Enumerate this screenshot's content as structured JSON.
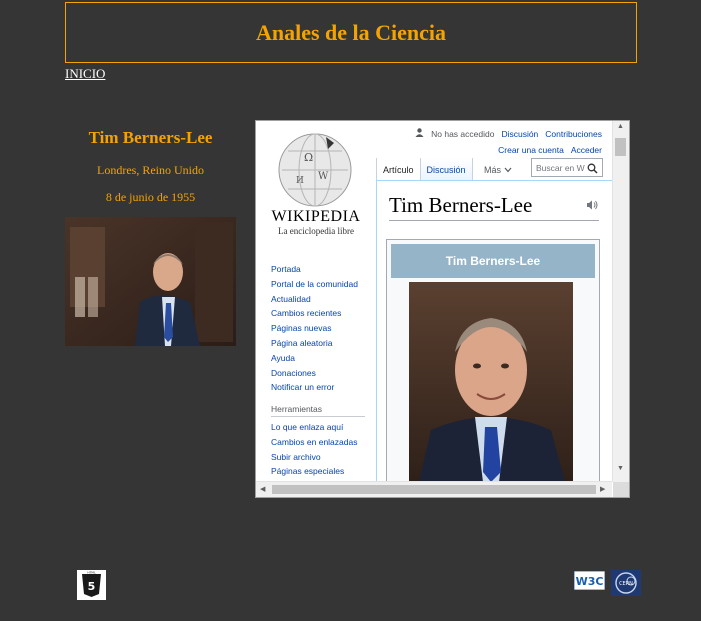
{
  "header": {
    "title": "Anales de la Ciencia"
  },
  "nav": {
    "home_label": "INICIO"
  },
  "person": {
    "name": "Tim Berners-Lee",
    "place": "Londres, Reino Unido",
    "date": "8 de junio de 1955"
  },
  "wiki": {
    "wordmark": "WIKIPEDIA",
    "tagline": "La enciclopedia libre",
    "personal_status": "No has accedido",
    "personal_links": [
      "Discusión",
      "Contribuciones"
    ],
    "personal_links2": [
      "Crear una cuenta",
      "Acceder"
    ],
    "tabs": [
      "Artículo",
      "Discusión"
    ],
    "more_label": "Más",
    "search_placeholder": "Buscar en W",
    "nav_links": [
      "Portada",
      "Portal de la comunidad",
      "Actualidad",
      "Cambios recientes",
      "Páginas nuevas",
      "Página aleatoria",
      "Ayuda",
      "Donaciones",
      "Notificar un error"
    ],
    "tools_heading": "Herramientas",
    "tools_links": [
      "Lo que enlaza aquí",
      "Cambios en enlazadas",
      "Subir archivo",
      "Páginas especiales"
    ],
    "page_title": "Tim Berners-Lee",
    "infobox_title": "Tim Berners-Lee"
  },
  "footer": {
    "left_badge_icon": "html5-icon",
    "right_badges": [
      "w3c-icon",
      "cern-icon"
    ]
  },
  "colors": {
    "accent": "#f5a300",
    "background": "#353535",
    "link": "#0645ad",
    "infobox_header": "#96b4c8"
  }
}
